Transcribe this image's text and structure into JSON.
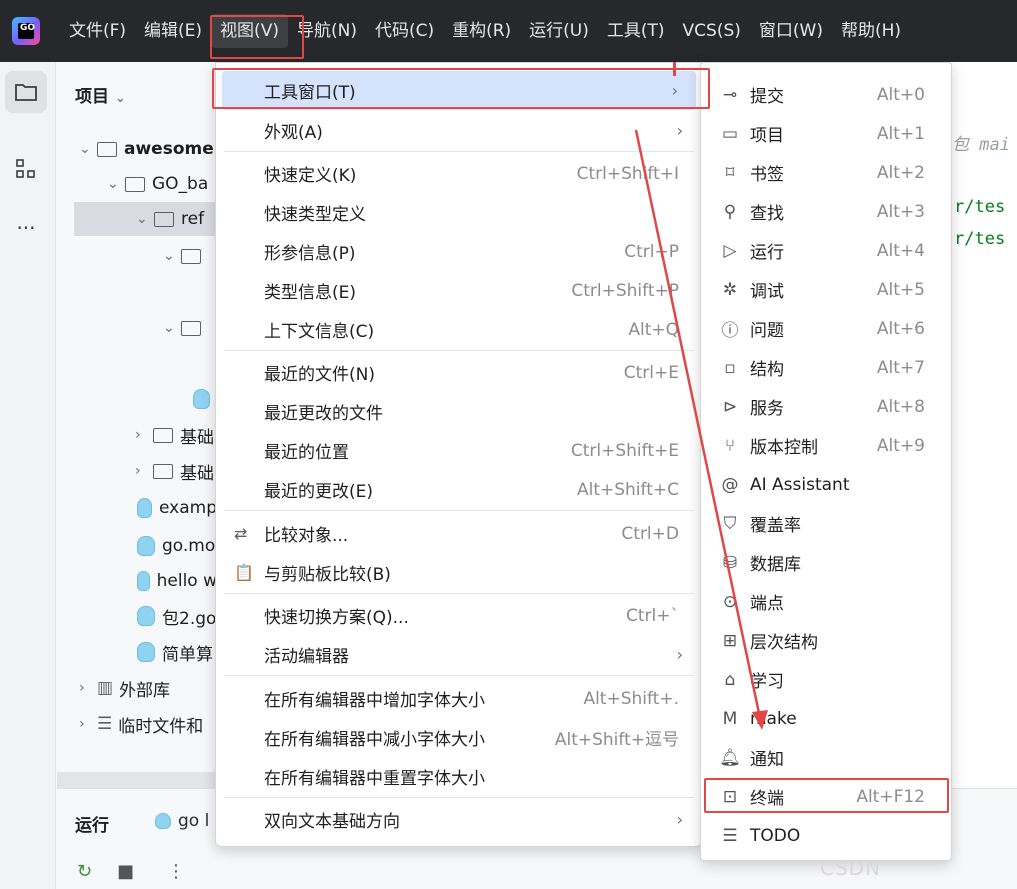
{
  "menubar": {
    "items": [
      "文件(F)",
      "编辑(E)",
      "视图(V)",
      "导航(N)",
      "代码(C)",
      "重构(R)",
      "运行(U)",
      "工具(T)",
      "VCS(S)",
      "窗口(W)",
      "帮助(H)"
    ],
    "active_index": 2,
    "logo_text": "GO"
  },
  "project": {
    "header": "项目",
    "tree": [
      {
        "label": "awesome",
        "bold": true
      },
      {
        "label": "GO_ba"
      },
      {
        "label": "ref"
      },
      {
        "label": ""
      },
      {
        "label": ""
      },
      {
        "label": ""
      },
      {
        "label": "基础"
      },
      {
        "label": "基础"
      },
      {
        "label": "examp"
      },
      {
        "label": "go.mo"
      },
      {
        "label": "hello w"
      },
      {
        "label": "包2.go"
      },
      {
        "label": "简单算"
      },
      {
        "label": "外部库"
      },
      {
        "label": "临时文件和"
      }
    ]
  },
  "bottom": {
    "run_label": "运行",
    "run_tab": "go l"
  },
  "editor": {
    "lines": [
      "包 mai",
      "r/tes",
      "r/tes"
    ]
  },
  "view_menu": {
    "items": [
      {
        "label": "工具窗口(T)",
        "shortcut": "",
        "submenu": true,
        "highlighted": true
      },
      {
        "label": "外观(A)",
        "shortcut": "",
        "submenu": true
      },
      {
        "label": "快速定义(K)",
        "shortcut": "Ctrl+Shift+I"
      },
      {
        "label": "快速类型定义",
        "shortcut": ""
      },
      {
        "label": "形参信息(P)",
        "shortcut": "Ctrl+P"
      },
      {
        "label": "类型信息(E)",
        "shortcut": "Ctrl+Shift+P"
      },
      {
        "label": "上下文信息(C)",
        "shortcut": "Alt+Q"
      },
      {
        "label": "最近的文件(N)",
        "shortcut": "Ctrl+E"
      },
      {
        "label": "最近更改的文件",
        "shortcut": ""
      },
      {
        "label": "最近的位置",
        "shortcut": "Ctrl+Shift+E"
      },
      {
        "label": "最近的更改(E)",
        "shortcut": "Alt+Shift+C"
      },
      {
        "label": "比较对象...",
        "shortcut": "Ctrl+D"
      },
      {
        "label": "与剪贴板比较(B)",
        "shortcut": ""
      },
      {
        "label": "快速切换方案(Q)...",
        "shortcut": "Ctrl+`"
      },
      {
        "label": "活动编辑器",
        "shortcut": "",
        "submenu": true
      },
      {
        "label": "在所有编辑器中增加字体大小",
        "shortcut": "Alt+Shift+."
      },
      {
        "label": "在所有编辑器中减小字体大小",
        "shortcut": "Alt+Shift+逗号"
      },
      {
        "label": "在所有编辑器中重置字体大小",
        "shortcut": ""
      },
      {
        "label": "双向文本基础方向",
        "shortcut": "",
        "submenu": true
      }
    ]
  },
  "tool_windows_menu": {
    "items": [
      {
        "label": "提交",
        "shortcut": "Alt+0",
        "icon": "commit-icon"
      },
      {
        "label": "项目",
        "shortcut": "Alt+1",
        "icon": "folder-icon"
      },
      {
        "label": "书签",
        "shortcut": "Alt+2",
        "icon": "bookmark-icon"
      },
      {
        "label": "查找",
        "shortcut": "Alt+3",
        "icon": "search-icon"
      },
      {
        "label": "运行",
        "shortcut": "Alt+4",
        "icon": "run-icon"
      },
      {
        "label": "调试",
        "shortcut": "Alt+5",
        "icon": "debug-icon"
      },
      {
        "label": "问题",
        "shortcut": "Alt+6",
        "icon": "problems-icon"
      },
      {
        "label": "结构",
        "shortcut": "Alt+7",
        "icon": "structure-icon"
      },
      {
        "label": "服务",
        "shortcut": "Alt+8",
        "icon": "services-icon"
      },
      {
        "label": "版本控制",
        "shortcut": "Alt+9",
        "icon": "vcs-icon"
      },
      {
        "label": "AI Assistant",
        "shortcut": "",
        "icon": "ai-assistant-icon"
      },
      {
        "label": "覆盖率",
        "shortcut": "",
        "icon": "coverage-icon"
      },
      {
        "label": "数据库",
        "shortcut": "",
        "icon": "database-icon"
      },
      {
        "label": "端点",
        "shortcut": "",
        "icon": "endpoints-icon"
      },
      {
        "label": "层次结构",
        "shortcut": "",
        "icon": "hierarchy-icon"
      },
      {
        "label": "学习",
        "shortcut": "",
        "icon": "learn-icon"
      },
      {
        "label": "make",
        "shortcut": "",
        "icon": "make-icon"
      },
      {
        "label": "通知",
        "shortcut": "",
        "icon": "notifications-icon"
      },
      {
        "label": "终端",
        "shortcut": "Alt+F12",
        "icon": "terminal-icon",
        "boxed": true
      },
      {
        "label": "TODO",
        "shortcut": "",
        "icon": "todo-icon"
      }
    ]
  },
  "colors": {
    "annotation_red": "#e04848",
    "highlight_blue": "#d4e2fb",
    "menubar_bg": "#27282c"
  }
}
